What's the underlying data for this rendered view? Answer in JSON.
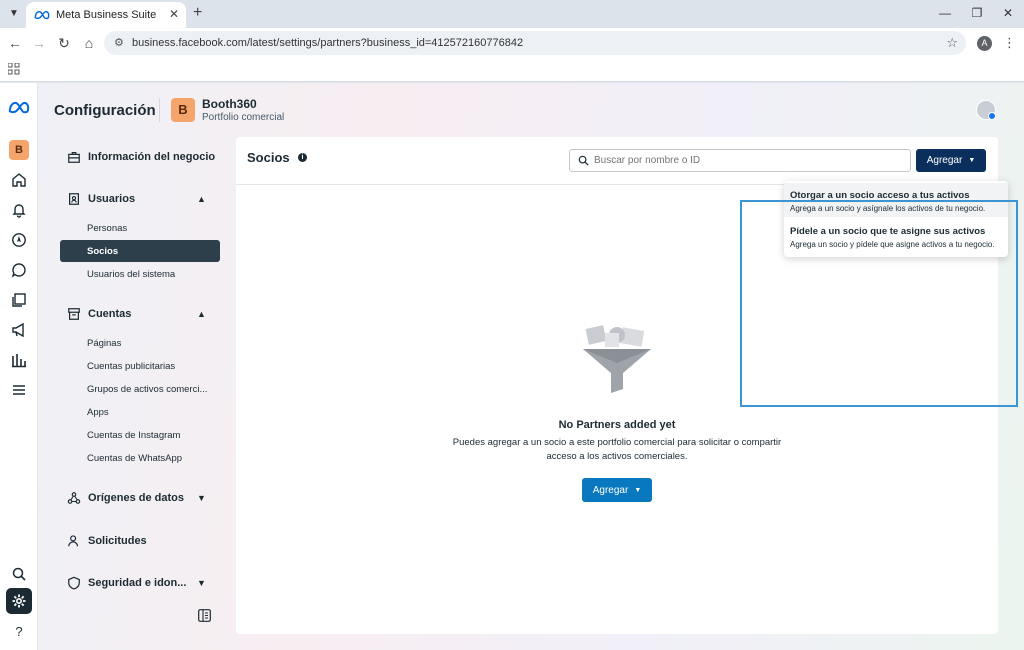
{
  "browser": {
    "tab_title": "Meta Business Suite",
    "url": "business.facebook.com/latest/settings/partners?business_id=412572160776842",
    "profile_initial": "A"
  },
  "header": {
    "title": "Configuración",
    "business_initial": "B",
    "business_name": "Booth360",
    "business_type": "Portfolio comercial"
  },
  "rail": {
    "business_initial": "B",
    "help_label": "?"
  },
  "sidebar": {
    "business_info": "Información del negocio",
    "users": {
      "label": "Usuarios",
      "items": [
        "Personas",
        "Socios",
        "Usuarios del sistema"
      ]
    },
    "accounts": {
      "label": "Cuentas",
      "items": [
        "Páginas",
        "Cuentas publicitarias",
        "Grupos de activos comerci...",
        "Apps",
        "Cuentas de Instagram",
        "Cuentas de WhatsApp"
      ]
    },
    "data_sources": "Orígenes de datos",
    "requests": "Solicitudes",
    "security": "Seguridad e idon..."
  },
  "main": {
    "title": "Socios",
    "search_placeholder": "Buscar por nombre o ID",
    "add_label": "Agregar",
    "empty_title": "No Partners added yet",
    "empty_description": "Puedes agregar a un socio a este portfolio comercial para solicitar o compartir acceso a los activos comerciales.",
    "empty_add_label": "Agregar"
  },
  "dropdown": {
    "items": [
      {
        "title": "Otorgar a un socio acceso a tus activos",
        "subtitle": "Agrega a un socio y asígnale los activos de tu negocio."
      },
      {
        "title": "Pídele a un socio que te asigne sus activos",
        "subtitle": "Agrega un socio y pídele que asigne activos a tu negocio."
      }
    ]
  },
  "colors": {
    "primary_button": "#0b2f5c",
    "blue_button": "#0a78be",
    "active_nav": "#2e3f4c",
    "highlight": "#3b95d3",
    "business_avatar": "#f5a56b"
  }
}
